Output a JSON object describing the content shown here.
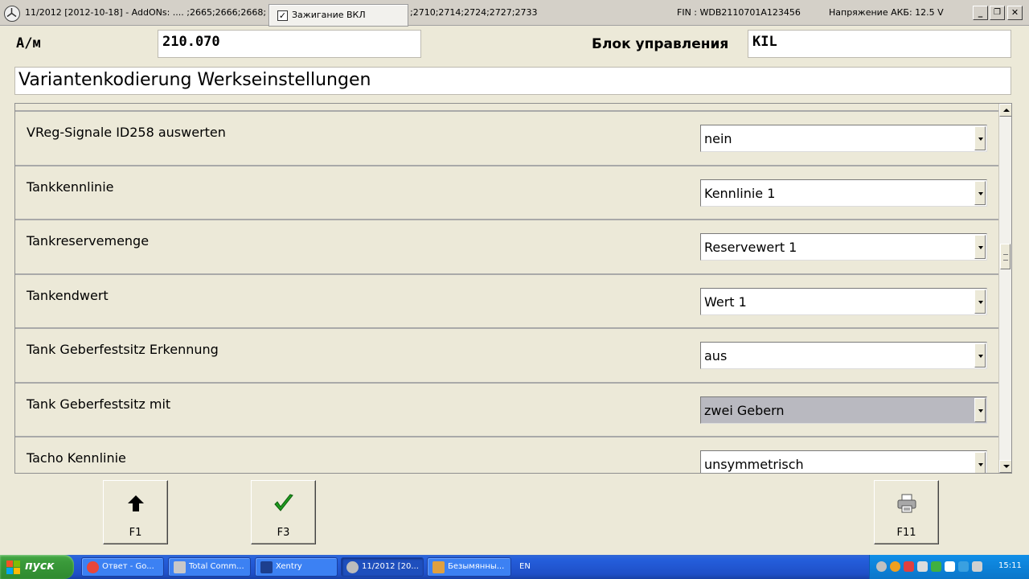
{
  "titlebar": {
    "title_left": "11/2012 [2012-10-18] - AddONs:  .... ;2665;2666;2668;",
    "title_codes": ";2710;2714;2724;2727;2733",
    "ignition_label": "Зажигание ВКЛ",
    "ignition_checked": true,
    "fin": "FIN : WDB2110701A123456",
    "voltage": "Напряжение АКБ: 12.5 V",
    "minimize_label": "_",
    "restore_label": "❐",
    "close_label": "✕"
  },
  "header": {
    "vehicle_label": "А/м",
    "vehicle_value": "210.070",
    "control_unit_label": "Блок управления",
    "control_unit_value": "KIL",
    "page_title": "Variantenkodierung Werkseinstellungen"
  },
  "parameters": [
    {
      "label": "VReg-Signale ID258 auswerten",
      "value": "nein",
      "selected": false
    },
    {
      "label": "Tankkennlinie",
      "value": "Kennlinie 1",
      "selected": false
    },
    {
      "label": "Tankreservemenge",
      "value": "Reservewert 1",
      "selected": false
    },
    {
      "label": "Tankendwert",
      "value": "Wert 1",
      "selected": false
    },
    {
      "label": "Tank Geberfestsitz Erkennung",
      "value": "aus",
      "selected": false
    },
    {
      "label": "Tank Geberfestsitz mit",
      "value": "zwei Gebern",
      "selected": true
    },
    {
      "label": "Tacho Kennlinie",
      "value": "unsymmetrisch",
      "selected": false
    }
  ],
  "scroll_position": 0.4,
  "function_keys": [
    {
      "label": "F1",
      "icon": "arrow-up-icon"
    },
    {
      "label": "F3",
      "icon": "checkmark-icon"
    },
    {
      "label": "F11",
      "icon": "printer-icon"
    }
  ],
  "taskbar": {
    "start_label": "пуск",
    "buttons": [
      {
        "label": "Ответ - Go...",
        "icon": "chrome-icon",
        "active": false
      },
      {
        "label": "Total Comm...",
        "icon": "total-commander-icon",
        "active": false
      },
      {
        "label": "Xentry",
        "icon": "xentry-icon",
        "active": false
      },
      {
        "label": "11/2012 [20...",
        "icon": "das-icon",
        "active": true
      },
      {
        "label": "Безымянны...",
        "icon": "paint-icon",
        "active": false
      }
    ],
    "language": "EN",
    "clock": "15:11"
  },
  "colors": {
    "window_bg": "#ece9d8",
    "selected_dropdown": "#b9b9c0",
    "taskbar_blue": "#245edb",
    "start_green": "#3a9a3a",
    "check_green": "#1f9a1f"
  }
}
